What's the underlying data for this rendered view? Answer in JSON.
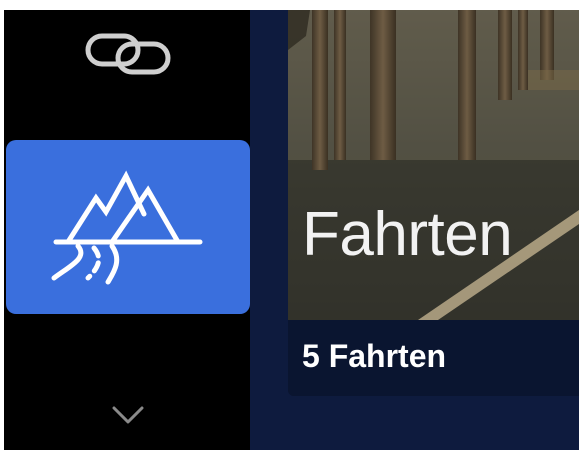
{
  "sidebar": {
    "top_icon": "link-icon",
    "selected_item": {
      "icon": "mountains-road-icon",
      "highlight_color": "#3a6fdd"
    },
    "bottom_icon": "chevron-down-icon"
  },
  "card": {
    "title": "Fahrten",
    "count_label": "5 Fahrten"
  },
  "colors": {
    "sidebar_bg": "#000000",
    "content_bg": "#0e1b3e",
    "caption_bg": "#0a1530"
  }
}
